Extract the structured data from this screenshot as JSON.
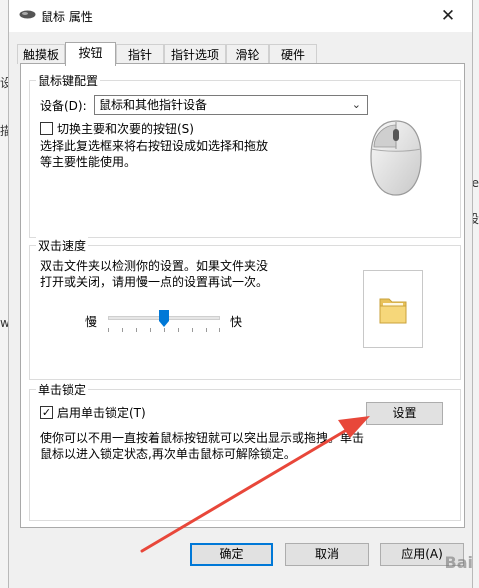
{
  "window": {
    "title": "鼠标 属性",
    "close_glyph": "✕"
  },
  "tabs": [
    {
      "label": "触摸板"
    },
    {
      "label": "按钮"
    },
    {
      "label": "指针"
    },
    {
      "label": "指针选项"
    },
    {
      "label": "滑轮"
    },
    {
      "label": "硬件"
    }
  ],
  "active_tab": "按钮",
  "button_config": {
    "title": "鼠标键配置",
    "device_label": "设备(D):",
    "device_value": "鼠标和其他指针设备",
    "swap_checkbox_label": "切换主要和次要的按钮(S)",
    "swap_checked": false,
    "description_line1": "选择此复选框来将右按钮设成如选择和拖放",
    "description_line2": "等主要性能使用。"
  },
  "double_click": {
    "title": "双击速度",
    "description_line1": "双击文件夹以检测你的设置。如果文件夹没",
    "description_line2": "打开或关闭，请用慢一点的设置再试一次。",
    "slow_label": "慢",
    "fast_label": "快",
    "speed_fraction": 0.5,
    "folder_icon": "folder-icon"
  },
  "click_lock": {
    "title": "单击锁定",
    "checkbox_label": "启用单击锁定(T)",
    "checked": true,
    "settings_button": "设置",
    "description_line1": "使你可以不用一直按着鼠标按钮就可以突出显示或拖拽。单击",
    "description_line2": "鼠标以进入锁定状态,再次单击鼠标可解除锁定。"
  },
  "footer": {
    "ok": "确定",
    "cancel": "取消",
    "apply": "应用(A)"
  },
  "background_glyphs": {
    "left1": "设",
    "left2": "描",
    "left3": "w",
    "right1": "e",
    "right2": "设"
  },
  "annotation": {
    "type": "red-arrow",
    "color": "#e8473a"
  },
  "watermark": "Bai"
}
